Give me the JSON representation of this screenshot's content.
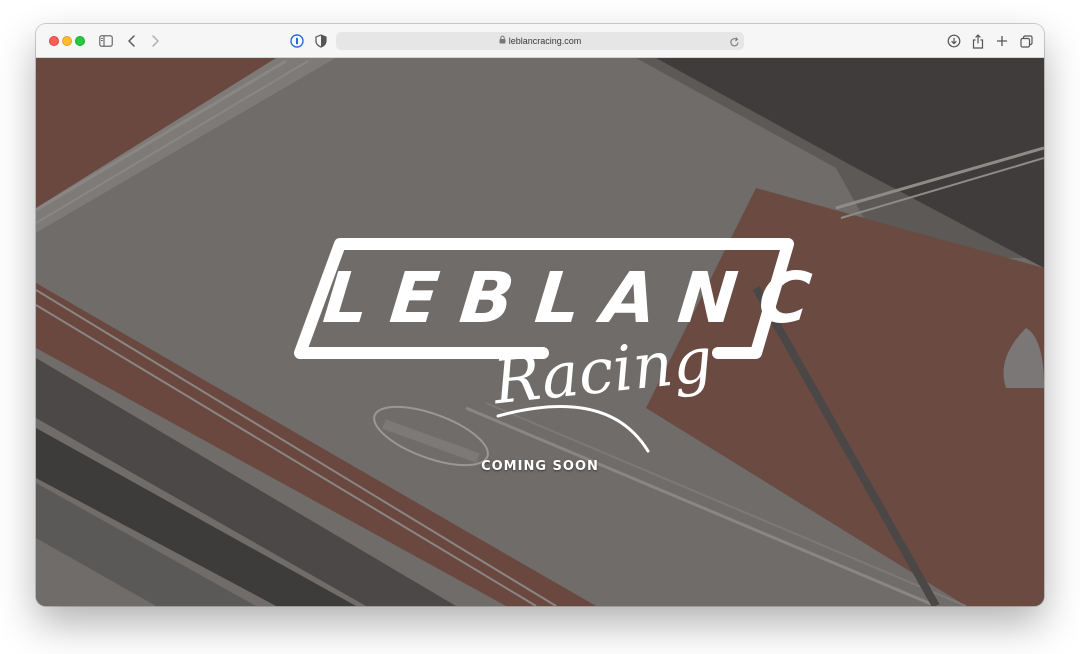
{
  "browser": {
    "url": "leblancracing.com",
    "icons": {
      "sidebar": "sidebar-icon",
      "back": "back-chevron-icon",
      "forward": "forward-chevron-icon",
      "password": "password-manager-icon",
      "privacy": "shield-icon",
      "lock": "lock-icon",
      "reload": "reload-icon",
      "download": "download-icon",
      "share": "share-icon",
      "new_tab": "plus-icon",
      "tabs": "tab-overview-icon"
    }
  },
  "page": {
    "brand_name": "LEBLANC",
    "brand_script": "Racing",
    "tagline": "COMING SOON"
  },
  "colors": {
    "accent_stripe": "#b45a45",
    "overlay": "#5e5b59",
    "text": "#ffffff"
  }
}
